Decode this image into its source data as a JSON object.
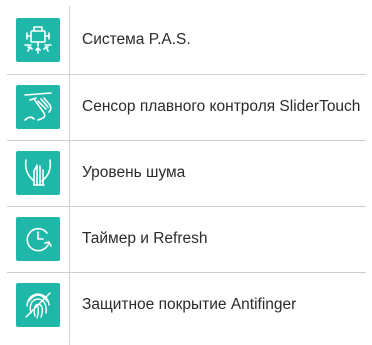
{
  "features": [
    {
      "icon": "pas-system-icon",
      "label": "Система P.A.S."
    },
    {
      "icon": "slider-touch-icon",
      "label": "Сенсор плавного контроля SliderTouch"
    },
    {
      "icon": "noise-level-icon",
      "label": "Уровень шума"
    },
    {
      "icon": "timer-refresh-icon",
      "label": "Таймер и Refresh"
    },
    {
      "icon": "fingerprint-icon",
      "label": "Защитное покрытие Antifinger"
    }
  ],
  "colors": {
    "icon_background": "#1fb7a8",
    "icon_foreground": "#ffffff",
    "divider": "#cfcfcf",
    "text": "#2b2b2b"
  }
}
